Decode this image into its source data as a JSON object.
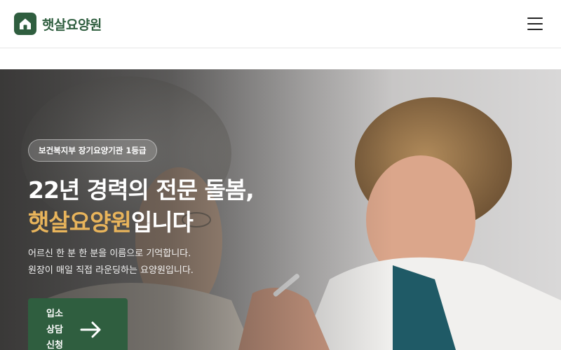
{
  "header": {
    "brand": "햇살요양원",
    "logo_icon": "house-icon",
    "menu_icon": "hamburger-menu-icon"
  },
  "hero": {
    "badge": "보건복지부 장기요양기관 1등급",
    "headline_line1": "22년 경력의 전문 돌봄,",
    "headline_accent": "햇살요양원",
    "headline_suffix": "입니다",
    "desc_line1": "어르신 한 분 한 분을 이름으로 기억합니다.",
    "desc_line2": "원장이 매일 직접 라운딩하는 요양원입니다.",
    "cta_label": "입소 상담 신청",
    "cta_icon": "arrow-right-icon"
  },
  "colors": {
    "brand_green": "#2f5e3f",
    "accent_gold": "#e8b45b",
    "white": "#ffffff"
  }
}
